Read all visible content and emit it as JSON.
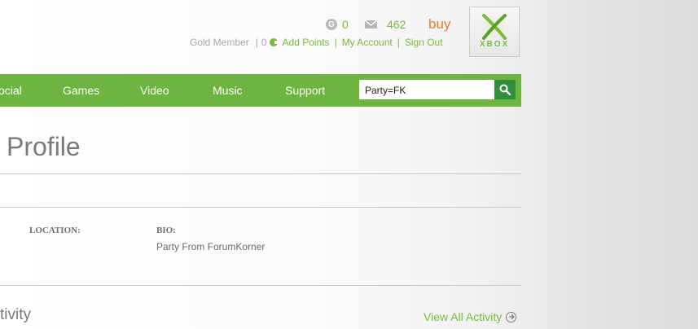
{
  "header": {
    "gold_points": "0",
    "messages": "462",
    "buy_label": "buy",
    "membership": "Gold Member",
    "points": "0",
    "add_points": "Add Points",
    "my_account": "My Account",
    "sign_out": "Sign Out",
    "logo_text": "XBOX",
    "g_icon_letter": "G",
    "separator": "|"
  },
  "nav": {
    "items": [
      "ocial",
      "Games",
      "Video",
      "Music",
      "Support"
    ],
    "search_value": "Party=FK"
  },
  "profile": {
    "title": "Profile",
    "location_label": "LOCATION:",
    "bio_label": "BIO:",
    "bio_value": "Party From ForumKorner"
  },
  "activity": {
    "title": "tivity",
    "view_all": "View All Activity"
  },
  "colors": {
    "green": "#6db540",
    "link_green": "#7ab93d",
    "buy_orange": "#e87b2c",
    "search_button": "#2f8f3a"
  }
}
